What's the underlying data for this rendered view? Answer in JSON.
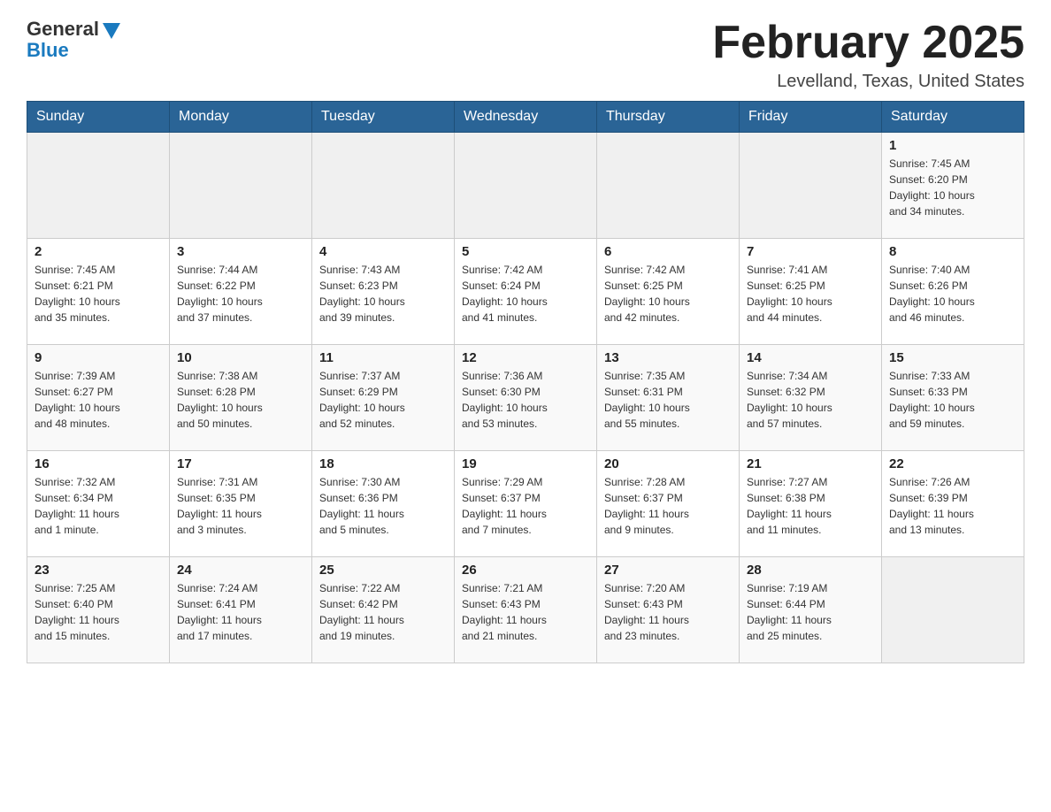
{
  "logo": {
    "general": "General",
    "blue": "Blue"
  },
  "title": "February 2025",
  "location": "Levelland, Texas, United States",
  "days_of_week": [
    "Sunday",
    "Monday",
    "Tuesday",
    "Wednesday",
    "Thursday",
    "Friday",
    "Saturday"
  ],
  "weeks": [
    [
      {
        "day": "",
        "info": ""
      },
      {
        "day": "",
        "info": ""
      },
      {
        "day": "",
        "info": ""
      },
      {
        "day": "",
        "info": ""
      },
      {
        "day": "",
        "info": ""
      },
      {
        "day": "",
        "info": ""
      },
      {
        "day": "1",
        "info": "Sunrise: 7:45 AM\nSunset: 6:20 PM\nDaylight: 10 hours\nand 34 minutes."
      }
    ],
    [
      {
        "day": "2",
        "info": "Sunrise: 7:45 AM\nSunset: 6:21 PM\nDaylight: 10 hours\nand 35 minutes."
      },
      {
        "day": "3",
        "info": "Sunrise: 7:44 AM\nSunset: 6:22 PM\nDaylight: 10 hours\nand 37 minutes."
      },
      {
        "day": "4",
        "info": "Sunrise: 7:43 AM\nSunset: 6:23 PM\nDaylight: 10 hours\nand 39 minutes."
      },
      {
        "day": "5",
        "info": "Sunrise: 7:42 AM\nSunset: 6:24 PM\nDaylight: 10 hours\nand 41 minutes."
      },
      {
        "day": "6",
        "info": "Sunrise: 7:42 AM\nSunset: 6:25 PM\nDaylight: 10 hours\nand 42 minutes."
      },
      {
        "day": "7",
        "info": "Sunrise: 7:41 AM\nSunset: 6:25 PM\nDaylight: 10 hours\nand 44 minutes."
      },
      {
        "day": "8",
        "info": "Sunrise: 7:40 AM\nSunset: 6:26 PM\nDaylight: 10 hours\nand 46 minutes."
      }
    ],
    [
      {
        "day": "9",
        "info": "Sunrise: 7:39 AM\nSunset: 6:27 PM\nDaylight: 10 hours\nand 48 minutes."
      },
      {
        "day": "10",
        "info": "Sunrise: 7:38 AM\nSunset: 6:28 PM\nDaylight: 10 hours\nand 50 minutes."
      },
      {
        "day": "11",
        "info": "Sunrise: 7:37 AM\nSunset: 6:29 PM\nDaylight: 10 hours\nand 52 minutes."
      },
      {
        "day": "12",
        "info": "Sunrise: 7:36 AM\nSunset: 6:30 PM\nDaylight: 10 hours\nand 53 minutes."
      },
      {
        "day": "13",
        "info": "Sunrise: 7:35 AM\nSunset: 6:31 PM\nDaylight: 10 hours\nand 55 minutes."
      },
      {
        "day": "14",
        "info": "Sunrise: 7:34 AM\nSunset: 6:32 PM\nDaylight: 10 hours\nand 57 minutes."
      },
      {
        "day": "15",
        "info": "Sunrise: 7:33 AM\nSunset: 6:33 PM\nDaylight: 10 hours\nand 59 minutes."
      }
    ],
    [
      {
        "day": "16",
        "info": "Sunrise: 7:32 AM\nSunset: 6:34 PM\nDaylight: 11 hours\nand 1 minute."
      },
      {
        "day": "17",
        "info": "Sunrise: 7:31 AM\nSunset: 6:35 PM\nDaylight: 11 hours\nand 3 minutes."
      },
      {
        "day": "18",
        "info": "Sunrise: 7:30 AM\nSunset: 6:36 PM\nDaylight: 11 hours\nand 5 minutes."
      },
      {
        "day": "19",
        "info": "Sunrise: 7:29 AM\nSunset: 6:37 PM\nDaylight: 11 hours\nand 7 minutes."
      },
      {
        "day": "20",
        "info": "Sunrise: 7:28 AM\nSunset: 6:37 PM\nDaylight: 11 hours\nand 9 minutes."
      },
      {
        "day": "21",
        "info": "Sunrise: 7:27 AM\nSunset: 6:38 PM\nDaylight: 11 hours\nand 11 minutes."
      },
      {
        "day": "22",
        "info": "Sunrise: 7:26 AM\nSunset: 6:39 PM\nDaylight: 11 hours\nand 13 minutes."
      }
    ],
    [
      {
        "day": "23",
        "info": "Sunrise: 7:25 AM\nSunset: 6:40 PM\nDaylight: 11 hours\nand 15 minutes."
      },
      {
        "day": "24",
        "info": "Sunrise: 7:24 AM\nSunset: 6:41 PM\nDaylight: 11 hours\nand 17 minutes."
      },
      {
        "day": "25",
        "info": "Sunrise: 7:22 AM\nSunset: 6:42 PM\nDaylight: 11 hours\nand 19 minutes."
      },
      {
        "day": "26",
        "info": "Sunrise: 7:21 AM\nSunset: 6:43 PM\nDaylight: 11 hours\nand 21 minutes."
      },
      {
        "day": "27",
        "info": "Sunrise: 7:20 AM\nSunset: 6:43 PM\nDaylight: 11 hours\nand 23 minutes."
      },
      {
        "day": "28",
        "info": "Sunrise: 7:19 AM\nSunset: 6:44 PM\nDaylight: 11 hours\nand 25 minutes."
      },
      {
        "day": "",
        "info": ""
      }
    ]
  ]
}
